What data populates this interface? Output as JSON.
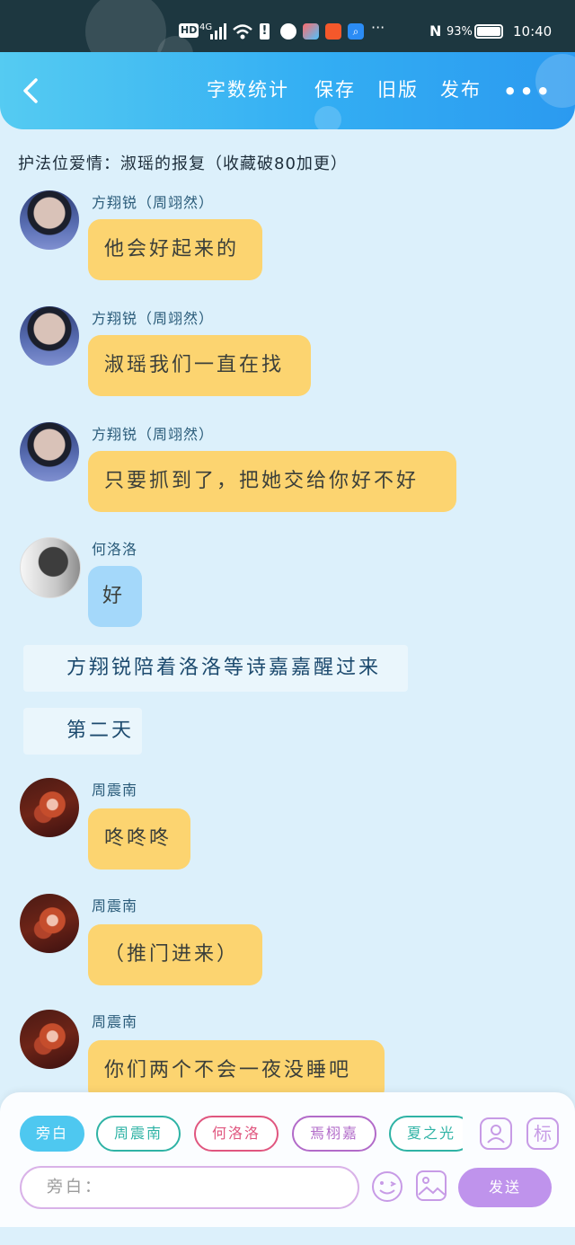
{
  "status_bar": {
    "hd": "HD",
    "network": "4G",
    "battery_percent": "93%",
    "time": "10:40",
    "icons": [
      "hd-icon",
      "signal-icon",
      "wifi-icon",
      "alert-icon",
      "app-icon",
      "app-icon",
      "app-icon",
      "search-app-icon",
      "more-icon",
      "nfc-icon",
      "battery-icon"
    ]
  },
  "header": {
    "actions": [
      "字数统计",
      "保存",
      "旧版",
      "发布"
    ],
    "more": "•••"
  },
  "story_title": "护法位爱情：淑瑶的报复（收藏破80加更）",
  "messages": [
    {
      "type": "chat",
      "speaker": "方翔锐（周翊然）",
      "text": "他会好起来的",
      "avatar": "boy",
      "bubble": "yellow"
    },
    {
      "type": "chat",
      "speaker": "方翔锐（周翊然）",
      "text": "淑瑶我们一直在找",
      "avatar": "boy",
      "bubble": "yellow"
    },
    {
      "type": "chat",
      "speaker": "方翔锐（周翊然）",
      "text": "只要抓到了，把她交给你好不好",
      "avatar": "boy",
      "bubble": "yellow"
    },
    {
      "type": "chat",
      "speaker": "何洛洛",
      "text": "好",
      "avatar": "grey",
      "bubble": "blue"
    },
    {
      "type": "narration",
      "text": "方翔锐陪着洛洛等诗嘉嘉醒过来"
    },
    {
      "type": "narration",
      "text": "第二天"
    },
    {
      "type": "chat",
      "speaker": "周震南",
      "text": "咚咚咚",
      "avatar": "red",
      "bubble": "yellow"
    },
    {
      "type": "chat",
      "speaker": "周震南",
      "text": "（推门进来）",
      "avatar": "red",
      "bubble": "yellow"
    },
    {
      "type": "chat",
      "speaker": "周震南",
      "text": "你们两个不会一夜没睡吧",
      "avatar": "red",
      "bubble": "yellow"
    }
  ],
  "roles": [
    {
      "label": "旁白",
      "color": "#4ec8f0",
      "selected": true
    },
    {
      "label": "周震南",
      "color": "#2fb3a5",
      "selected": false
    },
    {
      "label": "何洛洛",
      "color": "#e0567f",
      "selected": false
    },
    {
      "label": "焉栩嘉",
      "color": "#b26bc9",
      "selected": false
    },
    {
      "label": "夏之光",
      "color": "#2fb3a5",
      "selected": false
    }
  ],
  "panel": {
    "input_placeholder": "旁白：",
    "send_label": "发送",
    "mark_label": "标",
    "accent": "#bf93ec"
  }
}
